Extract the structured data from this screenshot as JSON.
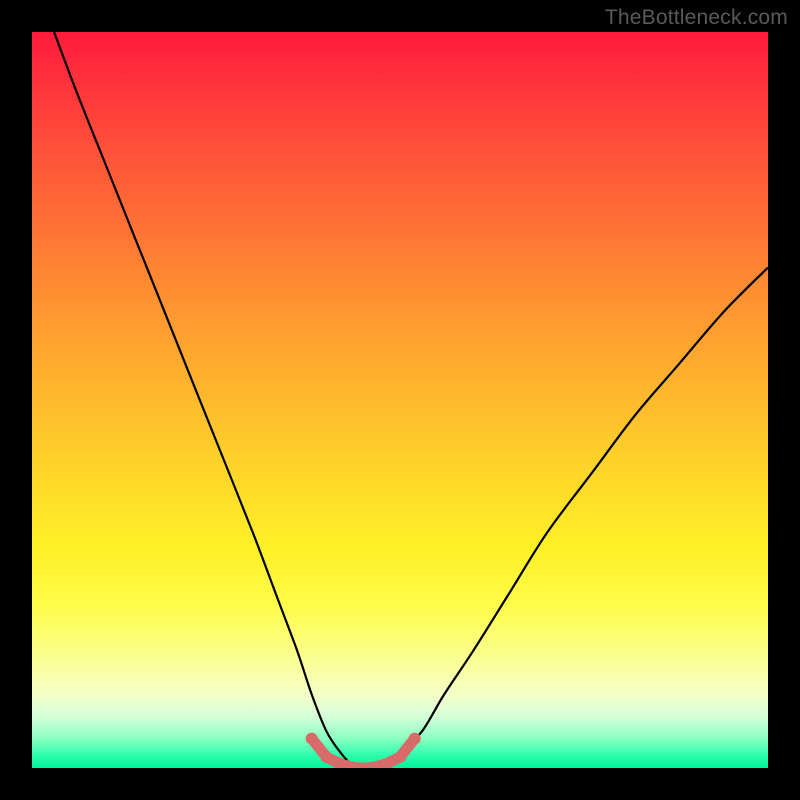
{
  "watermark": "TheBottleneck.com",
  "colors": {
    "page_bg": "#000000",
    "curve": "#000000",
    "marker": "#d86a6a",
    "gradient_top": "#ff1a3c",
    "gradient_bottom": "#00f39a"
  },
  "chart_data": {
    "type": "line",
    "title": "",
    "xlabel": "",
    "ylabel": "",
    "xlim": [
      0,
      100
    ],
    "ylim": [
      0,
      100
    ],
    "grid": false,
    "legend": false,
    "annotations": [],
    "series": [
      {
        "name": "bottleneck-curve",
        "x": [
          3,
          6,
          10,
          14,
          18,
          22,
          26,
          30,
          33,
          36,
          38,
          40,
          42,
          44,
          46,
          48,
          50,
          53,
          56,
          60,
          65,
          70,
          76,
          82,
          88,
          94,
          100
        ],
        "y": [
          100,
          92,
          82,
          72,
          62,
          52,
          42,
          32,
          24,
          16,
          10,
          5,
          2,
          0,
          0,
          0,
          2,
          5,
          10,
          16,
          24,
          32,
          40,
          48,
          55,
          62,
          68
        ]
      }
    ],
    "markers": {
      "name": "bottleneck-floor",
      "x": [
        38,
        40,
        42,
        44,
        46,
        48,
        50,
        52
      ],
      "y": [
        4,
        1.5,
        0.5,
        0,
        0,
        0.5,
        1.5,
        4
      ],
      "radius": 6
    }
  }
}
